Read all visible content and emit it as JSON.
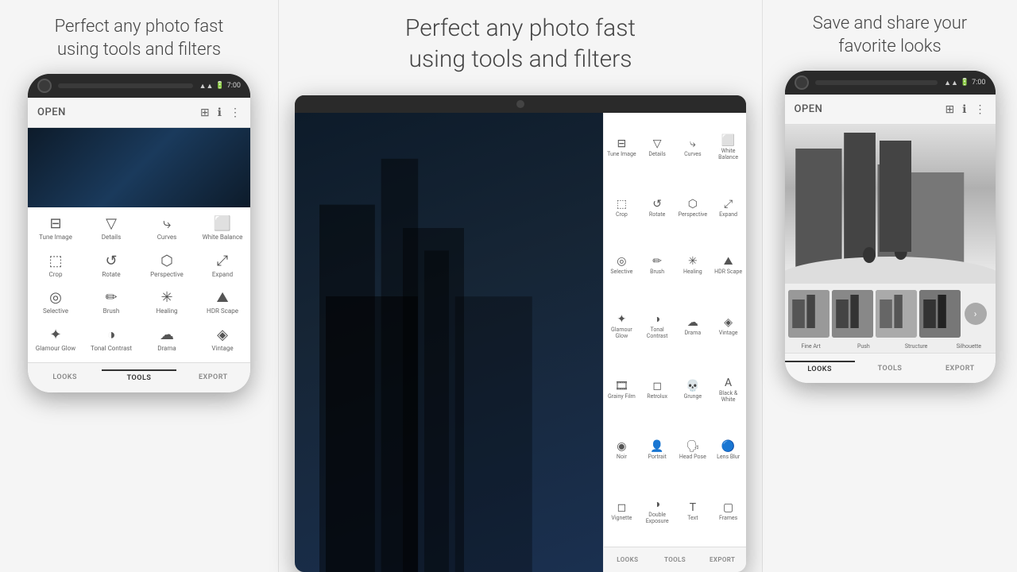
{
  "panels": {
    "left": {
      "heading": "Perfect any photo fast\nusing tools and filters",
      "phone": {
        "status": "7:00",
        "header_title": "OPEN",
        "tools": [
          {
            "icon": "⊟",
            "label": "Tune Image"
          },
          {
            "icon": "▽",
            "label": "Details"
          },
          {
            "icon": "⤷",
            "label": "Curves"
          },
          {
            "icon": "⬜",
            "label": "White Balance"
          },
          {
            "icon": "⬚",
            "label": "Crop"
          },
          {
            "icon": "↺",
            "label": "Rotate"
          },
          {
            "icon": "⬡",
            "label": "Perspective"
          },
          {
            "icon": "⤢",
            "label": "Expand"
          },
          {
            "icon": "◎",
            "label": "Selective"
          },
          {
            "icon": "✏",
            "label": "Brush"
          },
          {
            "icon": "✳",
            "label": "Healing"
          },
          {
            "icon": "⛰",
            "label": "HDR Scape"
          },
          {
            "icon": "✦",
            "label": "Glamour Glow"
          },
          {
            "icon": "◑",
            "label": "Tonal Contrast"
          },
          {
            "icon": "☁",
            "label": "Drama"
          },
          {
            "icon": "◈",
            "label": "Vintage"
          }
        ],
        "bottom_tabs": [
          "LOOKS",
          "TOOLS",
          "EXPORT"
        ]
      }
    },
    "center": {
      "heading": "Perfect any photo fast\nusing tools and filters",
      "tablet": {
        "tools": [
          {
            "icon": "⊟",
            "label": "Tune Image"
          },
          {
            "icon": "▽",
            "label": "Details"
          },
          {
            "icon": "⤷",
            "label": "Curves"
          },
          {
            "icon": "⬜",
            "label": "White Balance"
          },
          {
            "icon": "⬚",
            "label": "Crop"
          },
          {
            "icon": "↺",
            "label": "Rotate"
          },
          {
            "icon": "⬡",
            "label": "Perspective"
          },
          {
            "icon": "⤢",
            "label": "Expand"
          },
          {
            "icon": "◎",
            "label": "Selective"
          },
          {
            "icon": "✏",
            "label": "Brush"
          },
          {
            "icon": "✳",
            "label": "Healing"
          },
          {
            "icon": "⛰",
            "label": "HDR Scape"
          },
          {
            "icon": "✦",
            "label": "Glamour Glow"
          },
          {
            "icon": "◑",
            "label": "Tonal Contrast"
          },
          {
            "icon": "☁",
            "label": "Drama"
          },
          {
            "icon": "◈",
            "label": "Vintage"
          },
          {
            "icon": "🎞",
            "label": "Grainy Film"
          },
          {
            "icon": "◻",
            "label": "Retrolux"
          },
          {
            "icon": "💀",
            "label": "Grunge"
          },
          {
            "icon": "A",
            "label": "Black & White"
          },
          {
            "icon": "◉",
            "label": "Noir"
          },
          {
            "icon": "👤",
            "label": "Portrait"
          },
          {
            "icon": "🗣",
            "label": "Head Pose"
          },
          {
            "icon": "🔵",
            "label": "Lens Blur"
          },
          {
            "icon": "◻",
            "label": "Vignette"
          },
          {
            "icon": "◑",
            "label": "Double Exposure"
          },
          {
            "icon": "T",
            "label": "Text"
          },
          {
            "icon": "▢",
            "label": "Frames"
          }
        ],
        "bottom_tabs": [
          "LOOKS",
          "TOOLS",
          "EXPORT"
        ]
      }
    },
    "right": {
      "heading": "Save and share your\nfavorite looks",
      "phone": {
        "status": "7:00",
        "header_title": "OPEN",
        "looks_labels": [
          "Fine Art",
          "Push",
          "Structure",
          "Silhouette"
        ],
        "bottom_tabs": [
          "LOOKS",
          "TOOLS",
          "EXPORT"
        ]
      }
    }
  }
}
